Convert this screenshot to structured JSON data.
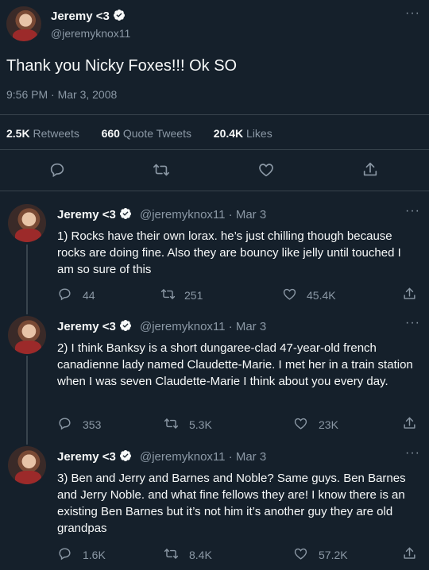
{
  "main_tweet": {
    "name": "Jeremy <3",
    "handle": "@jeremyknox11",
    "text": "Thank you Nicky Foxes!!! Ok SO",
    "timestamp": "9:56 PM · Mar 3, 2008",
    "stats": {
      "retweets_count": "2.5K",
      "retweets_label": "Retweets",
      "quotes_count": "660",
      "quotes_label": "Quote Tweets",
      "likes_count": "20.4K",
      "likes_label": "Likes"
    }
  },
  "replies": [
    {
      "name": "Jeremy <3",
      "handle": "@jeremyknox11",
      "date": "· Mar 3",
      "text": "1) Rocks have their own lorax. he’s just chilling though because rocks are doing fine. Also they are bouncy like jelly until touched I am so sure of this",
      "replies": "44",
      "retweets": "251",
      "likes": "45.4K"
    },
    {
      "name": "Jeremy <3",
      "handle": "@jeremyknox11",
      "date": "· Mar 3",
      "text": "2) I think Banksy is a short dungaree-clad 47-year-old french canadienne lady named Claudette-Marie. I met her in a train station when I was seven Claudette-Marie I think about you every day.",
      "replies": "353",
      "retweets": "5.3K",
      "likes": "23K"
    },
    {
      "name": "Jeremy <3",
      "handle": "@jeremyknox11",
      "date": "· Mar 3",
      "text": "3) Ben and Jerry and Barnes and Noble? Same guys. Ben Barnes and Jerry Noble. and what fine fellows they are! I know there is an existing Ben Barnes but it’s not him it’s another guy they are old grandpas",
      "replies": "1.6K",
      "retweets": "8.4K",
      "likes": "57.2K"
    }
  ],
  "icons": {
    "reply": "reply-icon",
    "retweet": "retweet-icon",
    "like": "heart-icon",
    "share": "share-icon",
    "more": "more-icon",
    "verified": "verified-badge-icon"
  },
  "colors": {
    "background": "#15202b",
    "text": "#f7f9f9",
    "muted": "#8b98a5",
    "accent": "#1d9bf0",
    "divider": "#38444d"
  },
  "more_label": "···"
}
